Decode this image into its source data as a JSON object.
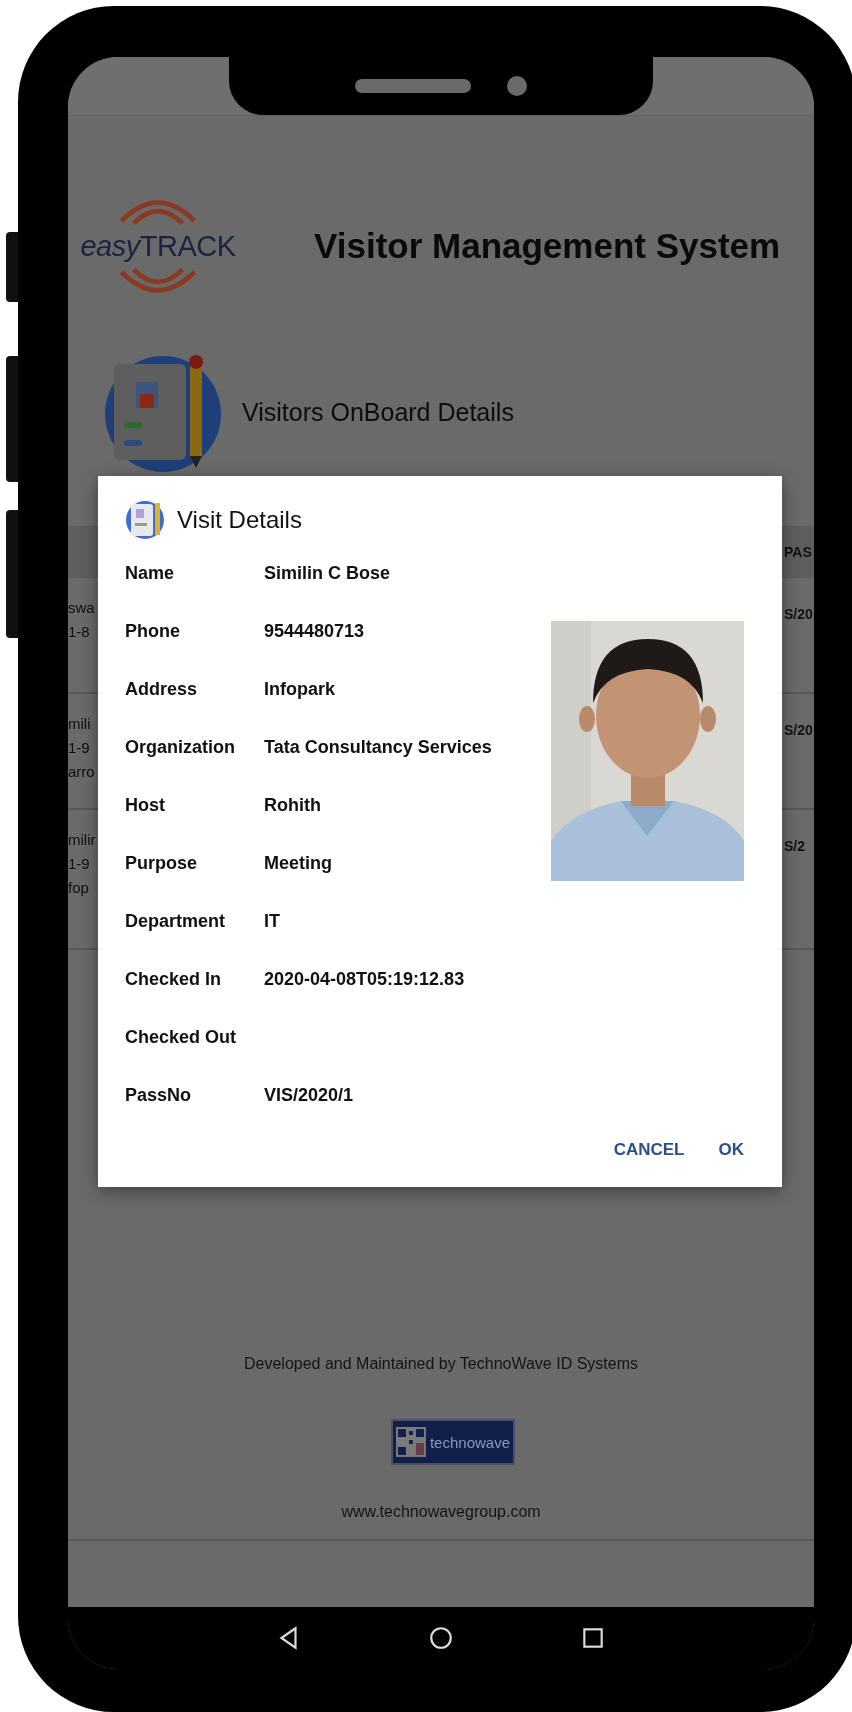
{
  "header": {
    "logo_prefix": "easy",
    "logo_word": "TRACK",
    "title": "Visitor Management System"
  },
  "section_title": "Visitors OnBoard Details",
  "table": {
    "header_right": "PAS",
    "rows": [
      {
        "column_1": [
          "swa",
          "1-8"
        ],
        "column_last": "S/20"
      },
      {
        "column_1": [
          "mili",
          "1-9",
          "arro"
        ],
        "column_last": "S/20"
      },
      {
        "column_1": [
          "milir",
          "1-9",
          "fop"
        ],
        "column_last": "S/2"
      }
    ]
  },
  "dialog": {
    "title": "Visit Details",
    "fields": [
      {
        "label": "Name",
        "value": "Similin C Bose"
      },
      {
        "label": "Phone",
        "value": "9544480713"
      },
      {
        "label": "Address",
        "value": "Infopark"
      },
      {
        "label": "Organization",
        "value": "Tata Consultancy Services"
      },
      {
        "label": "Host",
        "value": "Rohith"
      },
      {
        "label": "Purpose",
        "value": "Meeting"
      },
      {
        "label": "Department",
        "value": "IT"
      },
      {
        "label": "Checked In",
        "value": "2020-04-08T05:19:12.83"
      },
      {
        "label": "Checked Out"
      },
      {
        "label": "PassNo",
        "value": "VIS/2020/1"
      }
    ],
    "buttons": [
      "CANCEL",
      "OK"
    ]
  },
  "footer": {
    "credit": "Developed and Maintained by TechnoWave ID Systems",
    "logo_text": "technowave",
    "url": "www.technowavegroup.com"
  }
}
